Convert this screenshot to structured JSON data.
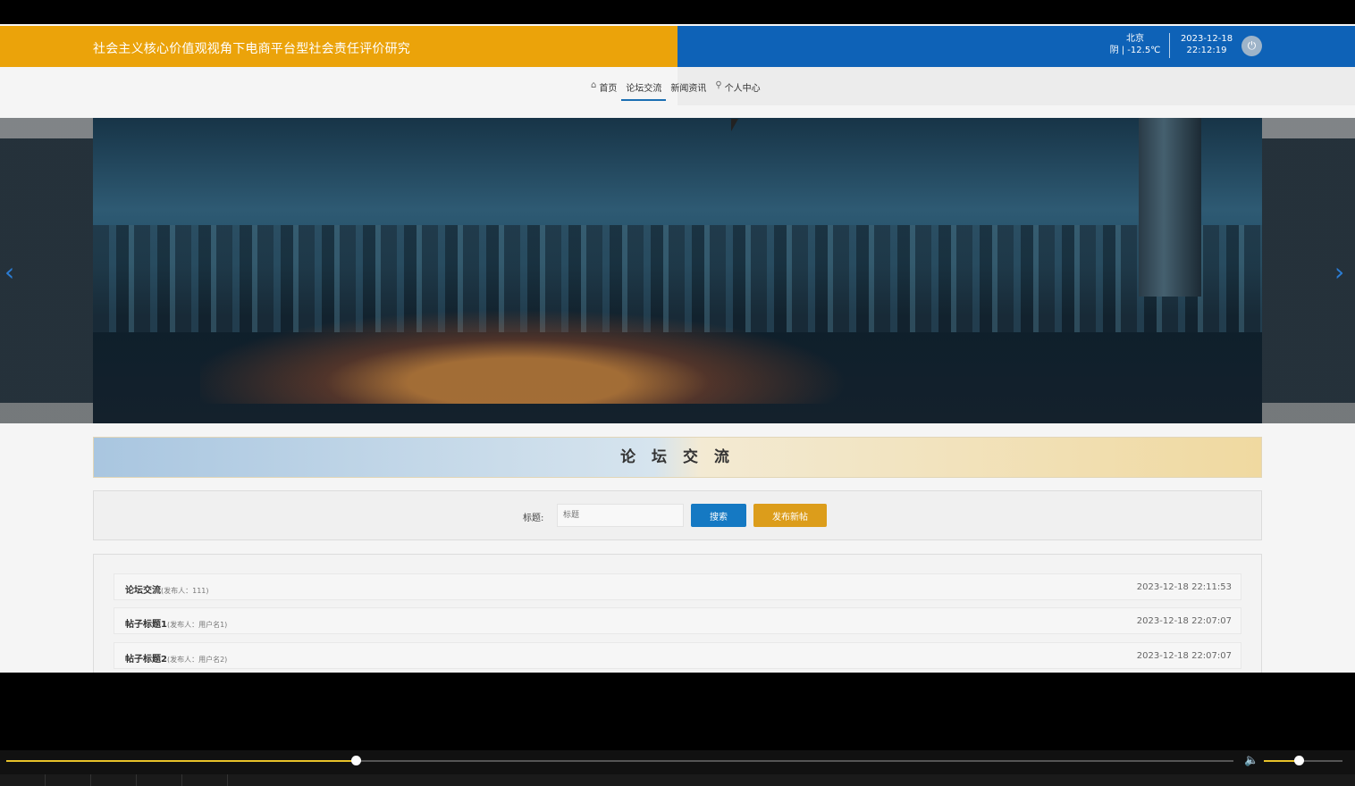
{
  "header": {
    "site_title": "社会主义核心价值观视角下电商平台型社会责任评价研究",
    "weather_city": "北京",
    "weather_desc": "阴 | -12.5℃",
    "date": "2023-12-18",
    "time": "22:12:19",
    "power_icon": "power-icon"
  },
  "nav": {
    "items": [
      {
        "label": "首页",
        "icon": "home-icon"
      },
      {
        "label": "论坛交流",
        "active": true
      },
      {
        "label": "新闻资讯"
      },
      {
        "label": "个人中心",
        "icon": "user-icon"
      }
    ]
  },
  "section": {
    "title": "论 坛 交 流"
  },
  "search": {
    "label": "标题:",
    "placeholder": "标题",
    "search_button": "搜索",
    "publish_button": "发布新帖"
  },
  "posts": [
    {
      "title": "论坛交流",
      "author": "(发布人：111)",
      "time": "2023-12-18 22:11:53"
    },
    {
      "title": "帖子标题1",
      "author": "(发布人：用户名1)",
      "time": "2023-12-18 22:07:07"
    },
    {
      "title": "帖子标题2",
      "author": "(发布人：用户名2)",
      "time": "2023-12-18 22:07:07"
    }
  ],
  "player": {
    "progress": 0.285,
    "volume": 0.44,
    "accent": "#e7c22a"
  },
  "colors": {
    "header_left": "#eba30a",
    "header_right": "#0e62b7",
    "search_button": "#1579c3",
    "publish_button": "#dc9d1b"
  }
}
